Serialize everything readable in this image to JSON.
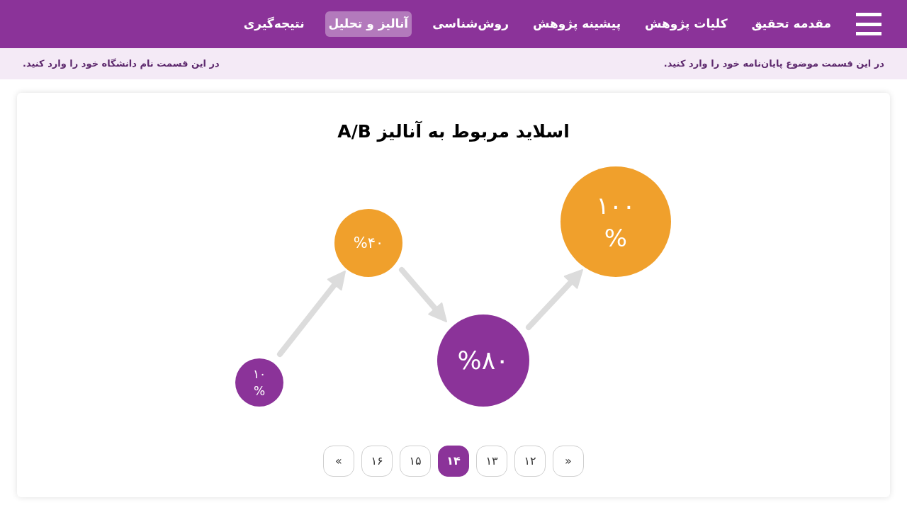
{
  "nav": {
    "items": [
      {
        "label": "مقدمه تحقیق",
        "selected": false
      },
      {
        "label": "کلیات پژوهش",
        "selected": false
      },
      {
        "label": "پیشینه پژوهش",
        "selected": false
      },
      {
        "label": "روش‌شناسی",
        "selected": false
      },
      {
        "label": "آنالیز و تحلیل",
        "selected": true
      },
      {
        "label": "نتیجه‌گیری",
        "selected": false
      }
    ]
  },
  "subheader": {
    "thesis_topic": "در این قسمت موضوع پایان‌نامه خود را وارد کنید.",
    "university": "در این قسمت نام دانشگاه خود را وارد کنید."
  },
  "slide": {
    "title": "اسلاید مربوط به آنالیز A/B",
    "bubbles": [
      {
        "label": "۱۰ %",
        "color": "#8b3399"
      },
      {
        "label": "%۴۰",
        "color": "#f0a02c"
      },
      {
        "label": "%۸۰",
        "color": "#8b3399"
      },
      {
        "label": "۱۰۰ %",
        "color": "#f0a02c"
      }
    ]
  },
  "pagination": {
    "pages": [
      {
        "label": "»",
        "selected": false
      },
      {
        "label": "۱۲",
        "selected": false
      },
      {
        "label": "۱۳",
        "selected": false
      },
      {
        "label": "۱۴",
        "selected": true
      },
      {
        "label": "۱۵",
        "selected": false
      },
      {
        "label": "۱۶",
        "selected": false
      },
      {
        "label": "«",
        "selected": false
      }
    ]
  }
}
